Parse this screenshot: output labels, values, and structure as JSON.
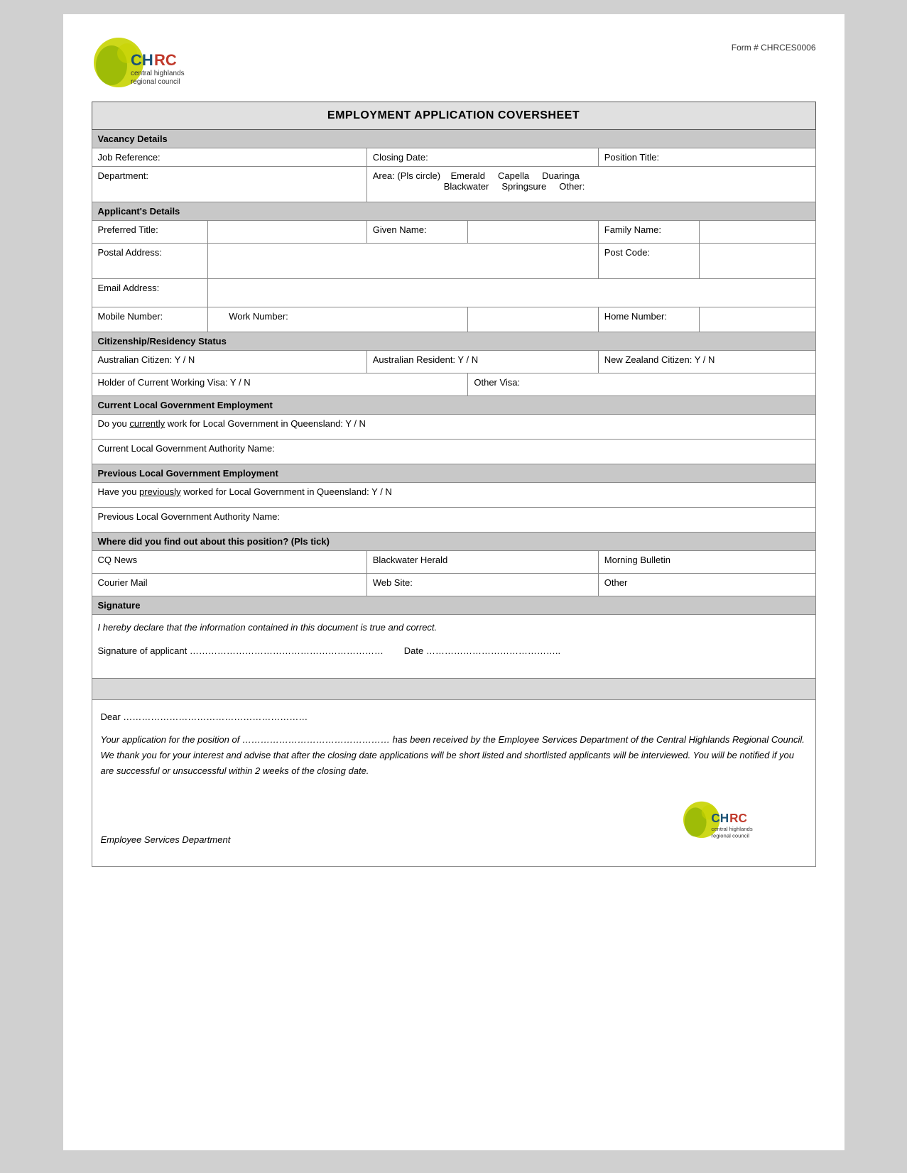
{
  "header": {
    "form_number": "Form # CHRCES0006",
    "org_name": "central highlands\nregional council",
    "org_abbr": "CHRC"
  },
  "form": {
    "title": "EMPLOYMENT APPLICATION COVERSHEET",
    "sections": {
      "vacancy": {
        "label": "Vacancy Details",
        "fields": {
          "job_reference": "Job Reference:",
          "closing_date": "Closing Date:",
          "position_title": "Position Title:",
          "department": "Department:",
          "area_label": "Area: (Pls circle)",
          "area_options": [
            "Emerald",
            "Capella",
            "Duaringa",
            "Blackwater",
            "Springsure",
            "Other:"
          ]
        }
      },
      "applicant": {
        "label": "Applicant's Details",
        "fields": {
          "preferred_title": "Preferred Title:",
          "given_name": "Given Name:",
          "family_name": "Family Name:",
          "postal_address": "Postal Address:",
          "post_code": "Post Code:",
          "email_address": "Email Address:",
          "mobile_number": "Mobile Number:",
          "work_number": "Work Number:",
          "home_number": "Home Number:"
        }
      },
      "citizenship": {
        "label": "Citizenship/Residency Status",
        "fields": {
          "aus_citizen": "Australian Citizen:  Y / N",
          "aus_resident": "Australian Resident:  Y / N",
          "nz_citizen": "New Zealand Citizen:  Y / N",
          "working_visa": "Holder of Current Working Visa: Y / N",
          "other_visa": "Other Visa:"
        }
      },
      "current_employment": {
        "label": "Current Local Government Employment",
        "fields": {
          "currently_work": "Do you",
          "currently_work_underline": "currently",
          "currently_work_rest": "work for Local Government in Queensland:   Y / N",
          "authority_name": "Current Local Government Authority Name:"
        }
      },
      "previous_employment": {
        "label": "Previous Local Government Employment",
        "fields": {
          "previously_work": "Have you",
          "previously_work_underline": "previously",
          "previously_work_rest": "worked for Local Government in Queensland:   Y / N",
          "authority_name": "Previous Local Government Authority Name:"
        }
      },
      "find_out": {
        "label": "Where did you find out about this position? (Pls tick)",
        "options_row1": [
          "CQ News",
          "Blackwater Herald",
          "Morning Bulletin"
        ],
        "options_row2": [
          "Courier Mail",
          "Web Site:",
          "Other"
        ]
      },
      "signature": {
        "label": "Signature",
        "declaration": "I hereby declare that the information contained in this document is true and correct.",
        "sig_line": "Signature of applicant ………………………………………………………",
        "date_line": "Date …………………………………….."
      }
    }
  },
  "letter": {
    "dear": "Dear ……………………………………………………",
    "body": "Your application for the position of ………………………………………… has been received by the Employee Services Department of the Central Highlands Regional Council. We thank you for your interest and advise that after the closing date applications will be short listed and shortlisted applicants will be interviewed. You will be notified if you are successful or unsuccessful within 2 weeks of the closing date.",
    "footer": "Employee Services Department"
  }
}
